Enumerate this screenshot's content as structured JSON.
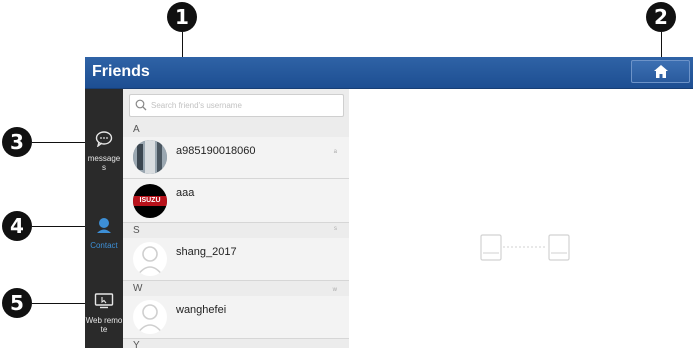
{
  "header": {
    "title": "Friends",
    "home_button": "home-icon"
  },
  "search": {
    "placeholder": "Search friend's username"
  },
  "sidebar": {
    "items": [
      {
        "label": "message s",
        "icon": "chat-bubble-icon",
        "active": false
      },
      {
        "label": "Contact",
        "icon": "person-icon",
        "active": true
      },
      {
        "label": "Web remote",
        "icon": "monitor-remote-icon",
        "active": false
      }
    ]
  },
  "contacts": {
    "sections": [
      {
        "letter": "A",
        "index": "a"
      },
      {
        "letter": "S",
        "index": "s"
      },
      {
        "letter": "W",
        "index": "w"
      },
      {
        "letter": "Y"
      }
    ],
    "rows": [
      {
        "name": "a985190018060"
      },
      {
        "name": "aaa",
        "avatar_text": "ISUZU"
      },
      {
        "name": "shang_2017"
      },
      {
        "name": "wanghefei"
      }
    ]
  },
  "callouts": [
    "1",
    "2",
    "3",
    "4",
    "5"
  ],
  "colors": {
    "titlebar": "#1d4e92",
    "sidebar": "#2a2a2a",
    "active": "#3d8fd6"
  }
}
